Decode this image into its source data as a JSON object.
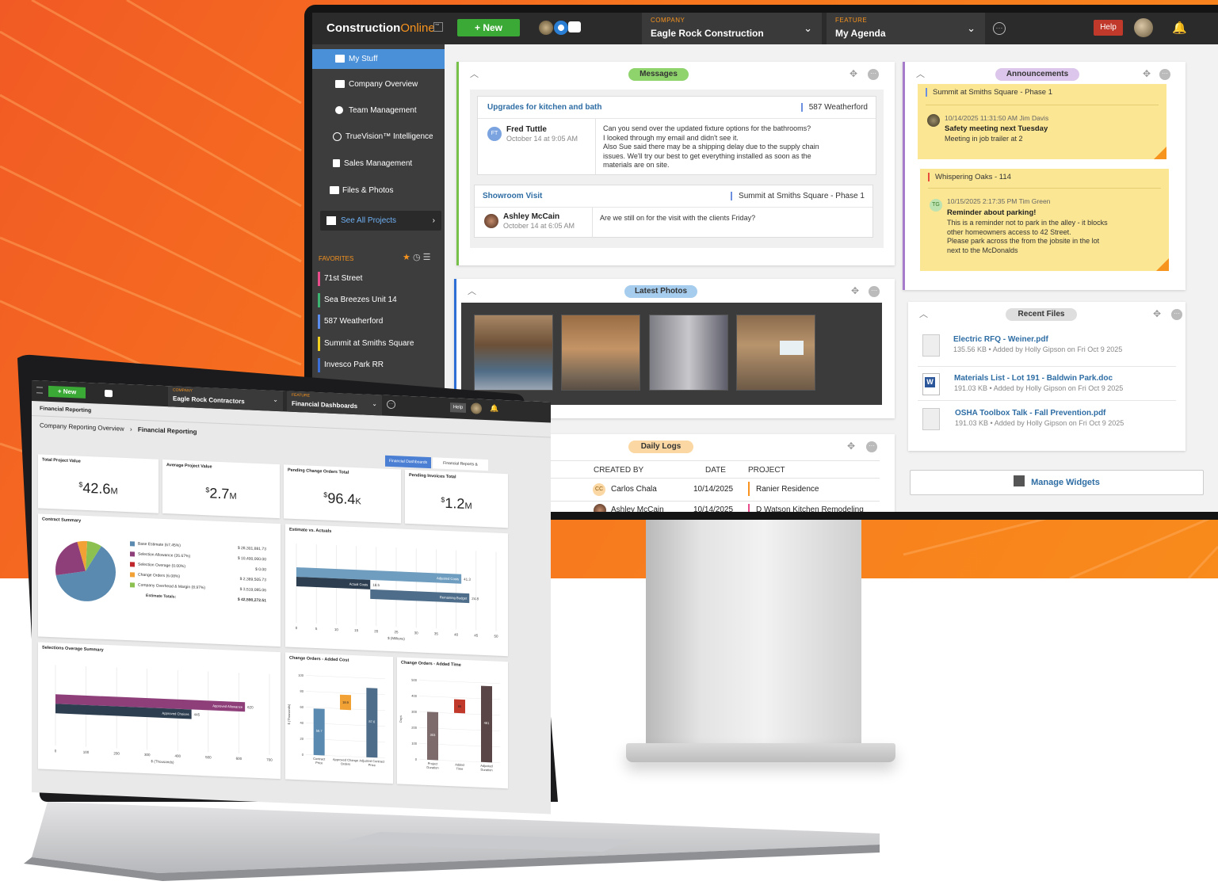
{
  "brand": {
    "name": "Construction",
    "accent": "Online",
    "tm": "™"
  },
  "monitor": {
    "new_label": "+ New",
    "company_caption": "COMPANY",
    "company_value": "Eagle Rock Construction",
    "feature_caption": "FEATURE",
    "feature_value": "My Agenda",
    "help_label": "Help",
    "sidebar": {
      "items": [
        {
          "label": "My Stuff",
          "icon": "folder-icon",
          "active": true
        },
        {
          "label": "Company Overview",
          "icon": "building-icon"
        },
        {
          "label": "Team Management",
          "icon": "person-icon"
        },
        {
          "label": "TrueVision™ Intelligence",
          "icon": "truevision-icon"
        },
        {
          "label": "Sales Management",
          "icon": "list-icon"
        },
        {
          "label": "Files & Photos",
          "icon": "folder-icon"
        }
      ],
      "see_all": "See All Projects",
      "favorites_label": "FAVORITES",
      "favorites": [
        {
          "label": "71st Street",
          "color": "#e84c8b"
        },
        {
          "label": "Sea Breezes Unit 14",
          "color": "#3cb371"
        },
        {
          "label": "587 Weatherford",
          "color": "#5b8def"
        },
        {
          "label": "Summit at Smiths Square",
          "color": "#f2d020"
        },
        {
          "label": "Invesco Park RR",
          "color": "#3a6fd8"
        }
      ]
    },
    "messages": {
      "title": "Messages",
      "items": [
        {
          "subject": "Upgrades for kitchen and bath",
          "project": "587 Weatherford",
          "initials": "FT",
          "from": "Fred Tuttle",
          "date": "October 14 at 9:05 AM",
          "lines": [
            "Can you send over the updated fixture options for the bathrooms?",
            "I looked through my email and didn't see it.",
            "Also Sue said there may be a shipping delay due to the supply chain",
            "issues. We'll try our best to get everything installed as soon as the",
            "materials are on site."
          ]
        },
        {
          "subject": "Showroom Visit",
          "project": "Summit at Smiths Square - Phase 1",
          "from": "Ashley McCain",
          "date": "October 14 at 6:05 AM",
          "lines": [
            "Are we still on for the visit with the clients Friday?"
          ]
        }
      ]
    },
    "announcements": {
      "title": "Announcements",
      "items": [
        {
          "project": "Summit at Smiths Square - Phase 1",
          "bar_color": "#6d8fe0",
          "meta": "10/14/2025 11:31:50 AM Jim Davis",
          "headline": "Safety meeting next Tuesday",
          "lines": [
            "Meeting in job trailer at 2"
          ]
        },
        {
          "project": "Whispering Oaks - 114",
          "bar_color": "#e84c3c",
          "initials": "TG",
          "meta": "10/15/2025 2:17:35 PM Tim Green",
          "headline": "Reminder about parking!",
          "lines": [
            "This is a reminder not to park in the alley - it blocks",
            "other homeowners access to 42 Street.",
            "Please park across the from the jobsite in the lot",
            "next to the McDonalds"
          ]
        }
      ]
    },
    "photos": {
      "title": "Latest Photos"
    },
    "files": {
      "title": "Recent Files",
      "items": [
        {
          "name": "Electric RFQ - Weiner.pdf",
          "meta": "135.56 KB • Added by Holly Gipson on Fri Oct 9 2025"
        },
        {
          "name": "Materials List - Lot 191 - Baldwin Park.doc",
          "meta": "191.03 KB • Added by Holly Gipson on Fri Oct 9 2025"
        },
        {
          "name": "OSHA Toolbox Talk - Fall Prevention.pdf",
          "meta": "191.03 KB • Added by Holly Gipson on Fri Oct 9 2025"
        }
      ]
    },
    "daily_logs": {
      "title": "Daily Logs",
      "columns": [
        "CREATED BY",
        "DATE",
        "PROJECT"
      ],
      "rows": [
        {
          "initials": "CC",
          "created_by": "Carlos Chala",
          "date": "10/14/2025",
          "project": "Ranier Residence"
        },
        {
          "created_by": "Ashley McCain",
          "date": "10/14/2025",
          "project": "D Watson Kitchen Remodeling"
        }
      ]
    },
    "manage_widgets": "Manage Widgets"
  },
  "laptop": {
    "new_label": "+ New",
    "company_caption": "COMPANY",
    "company_value": "Eagle Rock Contractors",
    "feature_caption": "FEATURE",
    "feature_value": "Financial Dashboards",
    "help_label": "Help",
    "page_title": "Financial Reporting",
    "breadcrumb_parent": "Company Reporting Overview",
    "breadcrumb_sep": "›",
    "breadcrumb_current": "Financial Reporting",
    "tabs": [
      "Financial Dashboards",
      "Financial Reports & Documents"
    ],
    "kpis": [
      {
        "label": "Total Project Value",
        "currency": "$",
        "value": "42.6",
        "unit": "M"
      },
      {
        "label": "Average Project Value",
        "currency": "$",
        "value": "2.7",
        "unit": "M"
      },
      {
        "label": "Pending Change Orders Total",
        "currency": "$",
        "value": "96.4",
        "unit": "K"
      },
      {
        "label": "Pending Invoices Total",
        "currency": "$",
        "value": "1.2",
        "unit": "M"
      }
    ]
  },
  "chart_data": [
    {
      "type": "pie",
      "title": "Contract Summary",
      "slices": [
        {
          "label": "Base Estimate (67.45%)",
          "value": 28301881.73,
          "display": "$ 28,301,881.73",
          "color": "#5a8ab0"
        },
        {
          "label": "Selection Allowance (26.67%)",
          "value": 10400000.0,
          "display": "$ 10,400,000.00",
          "color": "#8e3f7a"
        },
        {
          "label": "Selection Overage (0.00%)",
          "value": 0.0,
          "display": "$ 0.00",
          "color": "#c0272d"
        },
        {
          "label": "Change Orders (6.08%)",
          "value": 2389505.73,
          "display": "$ 2,389,505.73",
          "color": "#f2a134"
        },
        {
          "label": "Company Overhead & Margin (8.97%)",
          "value": 3519085.06,
          "display": "$ 3,519,085.06",
          "color": "#8cc152"
        }
      ],
      "total_label": "Estimate Totals:",
      "total_display": "$ 42,590,272.51"
    },
    {
      "type": "bar",
      "title": "Estimate vs. Actuals",
      "orientation": "horizontal",
      "series": [
        {
          "name": "Adjusted Costs",
          "values": [
            41.3
          ],
          "color": "#6f9dbf"
        },
        {
          "name": "Actual Costs",
          "values": [
            18.5
          ],
          "color": "#2d3e50"
        },
        {
          "name": "Remaining Budget",
          "values": [
            24.8
          ],
          "color": "#4d6d8a"
        }
      ],
      "xlabel": "$ (Millions)",
      "xticks": [
        0,
        5,
        10,
        15,
        20,
        25,
        30,
        35,
        40,
        45,
        50
      ],
      "xlim": [
        0,
        50
      ]
    },
    {
      "type": "bar",
      "title": "Selections Overage Summary",
      "orientation": "horizontal",
      "series": [
        {
          "name": "Approved Allowance",
          "values": [
            620
          ],
          "color": "#8e3f7a"
        },
        {
          "name": "Approved Choices",
          "values": [
            445
          ],
          "color": "#2d3e50"
        }
      ],
      "xlabel": "$ (Thousands)",
      "xticks": [
        0,
        100,
        200,
        300,
        400,
        500,
        600,
        700
      ],
      "xlim": [
        0,
        700
      ]
    },
    {
      "type": "bar",
      "title": "Change Orders - Added Cost",
      "categories": [
        "Contract Price",
        "Approved Change Orders",
        "Adjusted Contract Price"
      ],
      "values": [
        58.7,
        18.9,
        87.6
      ],
      "colors": [
        "#5a8ab0",
        "#f2a134",
        "#4d6d8a"
      ],
      "ylabel": "$ (Thousands)",
      "yticks": [
        0,
        20,
        40,
        60,
        80,
        100
      ],
      "ylim": [
        0,
        100
      ]
    },
    {
      "type": "bar",
      "title": "Change Orders - Added Time",
      "categories": [
        "Project Duration",
        "Added Time",
        "Adjusted Duration"
      ],
      "values": [
        303,
        86,
        481
      ],
      "colors": [
        "#7d6a6a",
        "#c0392b",
        "#5a4646"
      ],
      "ylabel": "Days",
      "yticks": [
        0,
        100,
        200,
        300,
        400,
        500
      ],
      "ylim": [
        0,
        500
      ]
    }
  ]
}
